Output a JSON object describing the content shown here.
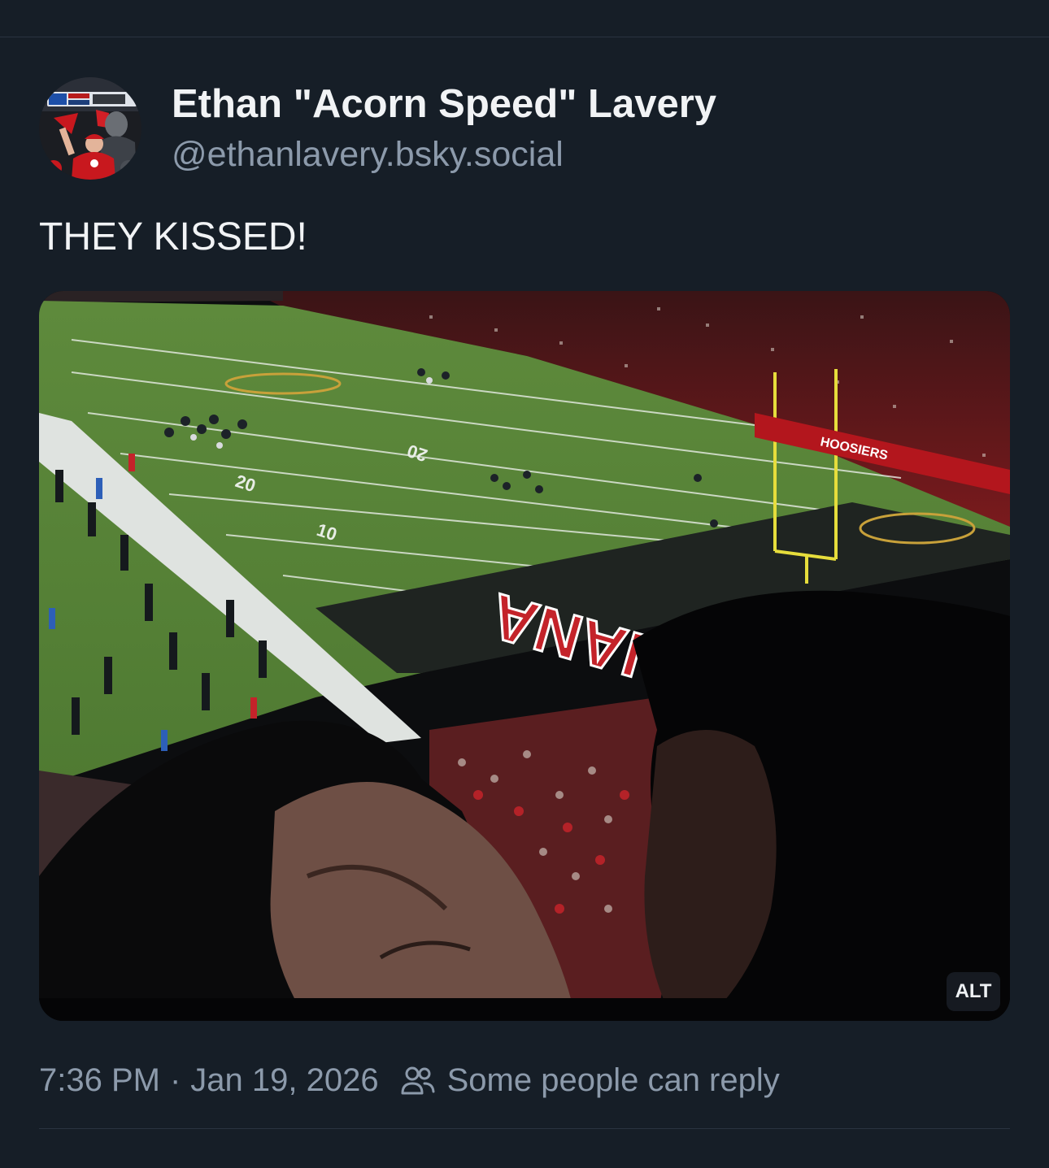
{
  "post": {
    "author": {
      "display_name": "Ethan \"Acorn Speed\" Lavery",
      "handle": "@ethanlavery.bsky.social",
      "avatar_icon": "avatar-photo-baseball-fans"
    },
    "text": "THEY KISSED!",
    "media": {
      "alt_badge": "ALT",
      "end_zone_text": "INDIANA",
      "banner_text": "HOOSIERS"
    },
    "meta": {
      "time": "7:36 PM",
      "separator": "·",
      "date": "Jan 19, 2026",
      "reply_icon": "people-icon",
      "reply_setting": "Some people can reply"
    }
  },
  "colors": {
    "background": "#161e27",
    "primary_text": "#f1f3f5",
    "secondary_text": "#8c9aab",
    "divider": "#2a3340"
  }
}
